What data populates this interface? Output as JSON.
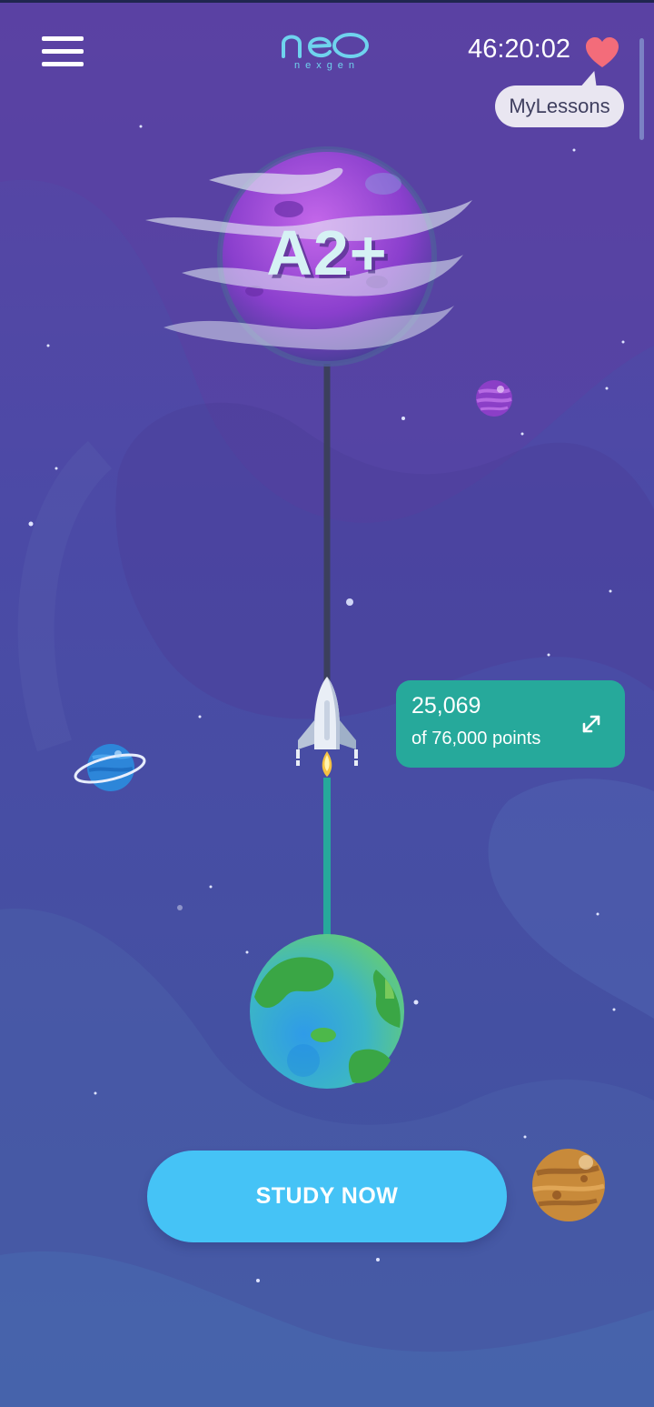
{
  "header": {
    "logo": {
      "wordmark": "neo",
      "tagline": "nexgen",
      "color": "#6fd3ee"
    },
    "menu_icon": "hamburger-menu-icon",
    "timer": "46:20:02",
    "lives_icon": "heart-icon",
    "my_lessons_label": "MyLessons"
  },
  "journey": {
    "target_level": "A2+",
    "progress": {
      "points": "25,069",
      "total_label": "of 76,000 points",
      "fraction": 0.33
    },
    "expand_icon": "expand-icon"
  },
  "cta": {
    "label": "STUDY NOW"
  },
  "colors": {
    "background": "#3f4c9a",
    "card": "#26a99b",
    "button": "#45c3f6",
    "heart": "#f36c7a",
    "progress_line": "#26a99b",
    "remaining_line": "#3b3f5c"
  }
}
